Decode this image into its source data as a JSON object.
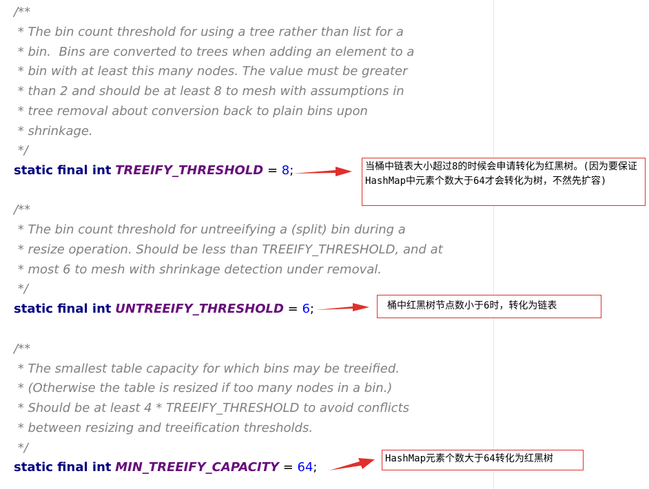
{
  "blocks": [
    {
      "comment": [
        "/**",
        " * The bin count threshold for using a tree rather than list for a",
        " * bin.  Bins are converted to trees when adding an element to a",
        " * bin with at least this many nodes. The value must be greater",
        " * than 2 and should be at least 8 to mesh with assumptions in",
        " * tree removal about conversion back to plain bins upon",
        " * shrinkage.",
        " */"
      ],
      "code": {
        "modifiers": "static final int",
        "name": "TREEIFY_THRESHOLD",
        "eq": " = ",
        "value": "8",
        "end": ";"
      }
    },
    {
      "comment": [
        "/**",
        " * The bin count threshold for untreeifying a (split) bin during a",
        " * resize operation. Should be less than TREEIFY_THRESHOLD, and at",
        " * most 6 to mesh with shrinkage detection under removal.",
        " */"
      ],
      "code": {
        "modifiers": "static final int",
        "name": "UNTREEIFY_THRESHOLD",
        "eq": " = ",
        "value": "6",
        "end": ";"
      }
    },
    {
      "comment": [
        "/**",
        " * The smallest table capacity for which bins may be treeified.",
        " * (Otherwise the table is resized if too many nodes in a bin.)",
        " * Should be at least 4 * TREEIFY_THRESHOLD to avoid conflicts",
        " * between resizing and treeification thresholds.",
        " */"
      ],
      "code": {
        "modifiers": "static final int",
        "name": "MIN_TREEIFY_CAPACITY",
        "eq": " = ",
        "value": "64",
        "end": ";"
      }
    }
  ],
  "annotations": [
    "当桶中链表大小超过8的时候会申请转化为红黑树。(因为要保证HashMap中元素个数大于64才会转化为树，不然先扩容)",
    "桶中红黑树节点数小于6时，转化为链表",
    "HashMap元素个数大于64转化为红黑树"
  ],
  "colors": {
    "comment": "#808080",
    "keyword": "#000080",
    "constant": "#660e7a",
    "number": "#0000ff",
    "annotation_border": "#e0302c",
    "arrow": "#e0302c"
  }
}
